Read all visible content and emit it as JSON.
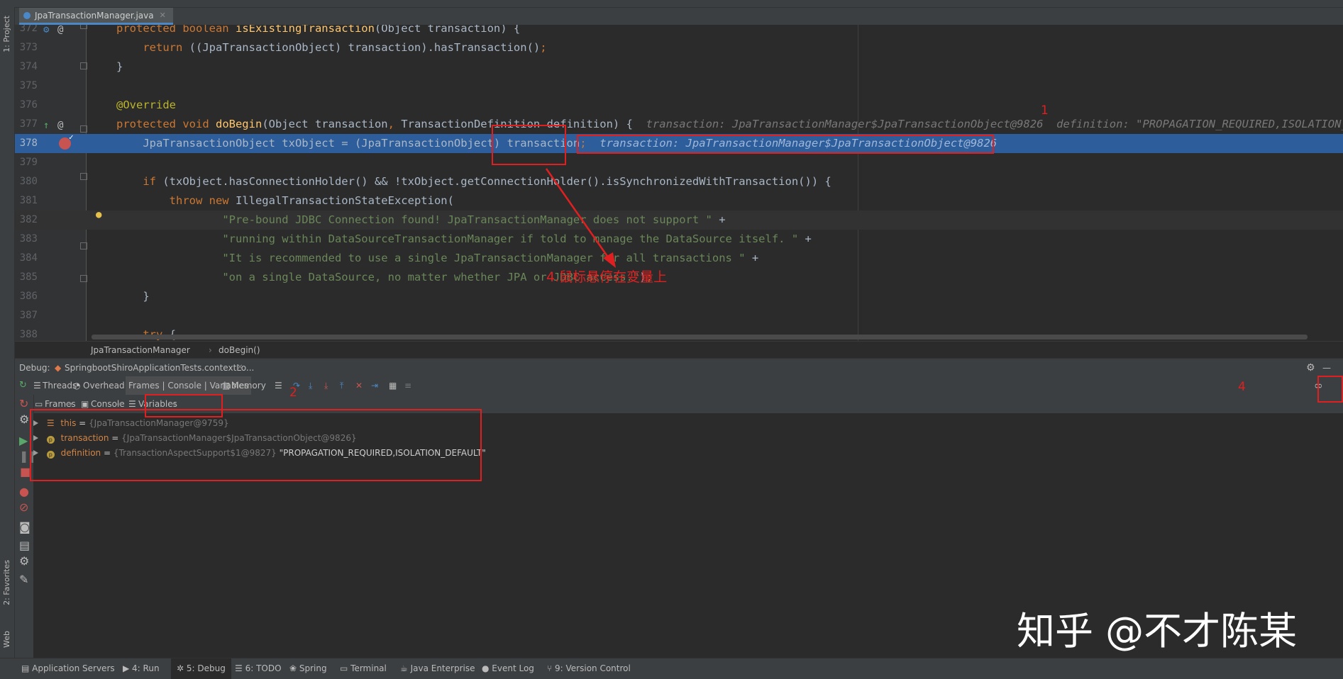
{
  "side_tabs": {
    "project": "1: Project",
    "favorites": "2: Favorites",
    "web": "Web"
  },
  "editor_tab": {
    "filename": "JpaTransactionManager.java"
  },
  "code_lines": [
    {
      "no": "372",
      "html": "<span class=\"kw\">protected boolean </span><span class=\"fn\">isExistingTransaction</span>(Object transaction) {"
    },
    {
      "no": "373",
      "html": "    <span class=\"kw\">return </span>((JpaTransactionObject) transaction).hasTransaction()<span class=\"kw\">;</span>"
    },
    {
      "no": "374",
      "html": "}"
    },
    {
      "no": "375",
      "html": ""
    },
    {
      "no": "376",
      "html": "<span class=\"an\">@Override</span>"
    },
    {
      "no": "377",
      "html": "<span class=\"kw\">protected void </span><span class=\"fn\">doBegin</span>(Object transaction<span class=\"kw\">, </span>TransactionDefinition definition) {  <span class=\"inl\">transaction: JpaTransactionManager$JpaTransactionObject@9826  definition: \"PROPAGATION_REQUIRED,ISOLATION_DEFAULT\"</span>"
    },
    {
      "no": "378",
      "html": "    JpaTransactionObject txObject = (JpaTransactionObject) transaction<span class=\"kw\">;  </span><span class=\"inl\">transaction: JpaTransactionManager$JpaTransactionObject@9826</span>"
    },
    {
      "no": "379",
      "html": ""
    },
    {
      "no": "380",
      "html": "    <span class=\"kw\">if </span>(txObject.hasConnectionHolder() &amp;&amp; !txObject.getConnectionHolder().isSynchronizedWithTransaction()) {"
    },
    {
      "no": "381",
      "html": "        <span class=\"kw\">throw new </span>IllegalTransactionStateException("
    },
    {
      "no": "382",
      "html": "                <span class=\"str\">\"Pre-bound JDBC Connection found! JpaTransactionManager does not support \"</span> +"
    },
    {
      "no": "383",
      "html": "                <span class=\"str\">\"running within DataSourceTransactionManager if told to manage the DataSource itself. \"</span> +"
    },
    {
      "no": "384",
      "html": "                <span class=\"str\">\"It is recommended to use a single JpaTransactionManager for all transactions \"</span> +"
    },
    {
      "no": "385",
      "html": "                <span class=\"str\">\"on a single DataSource, no matter whether JPA or JDBC access.\"</span>)<span class=\"kw\">;</span>"
    },
    {
      "no": "386",
      "html": "    }"
    },
    {
      "no": "387",
      "html": ""
    },
    {
      "no": "388",
      "html": "    <span class=\"kw\">try </span>{"
    }
  ],
  "breadcrumb": {
    "class": "JpaTransactionManager",
    "method": "doBegin()"
  },
  "debug": {
    "label": "Debug:",
    "session_tab": "SpringbootShiroApplicationTests.contextLo...",
    "toolbar": {
      "threads": "Threads",
      "overhead": "Overhead",
      "frames_console_variables": "Frames | Console | Variables",
      "memory": "Memory"
    },
    "subtabs": {
      "frames": "Frames",
      "console": "Console",
      "variables": "Variables"
    },
    "variables": [
      {
        "name": "this",
        "ref": "{JpaTransactionManager@9759}",
        "value": ""
      },
      {
        "name": "transaction",
        "ref": "{JpaTransactionManager$JpaTransactionObject@9826}",
        "value": ""
      },
      {
        "name": "definition",
        "ref": "{TransactionAspectSupport$1@9827}",
        "value": "\"PROPAGATION_REQUIRED,ISOLATION_DEFAULT\""
      }
    ]
  },
  "status_tabs": [
    "Application Servers",
    "4: Run",
    "5: Debug",
    "6: TODO",
    "Spring",
    "Terminal",
    "Java Enterprise",
    "Event Log",
    "9: Version Control"
  ],
  "annotations": {
    "n1": "1",
    "n2": "2",
    "n4": "4",
    "note": "4.鼠标悬停在变量上"
  },
  "watermark": "知乎 @不才陈某",
  "colors": {
    "highlight": "#2d5d9b",
    "annotation_red": "#e02020",
    "keyword": "#cc7832",
    "string": "#6a8759",
    "method": "#ffc66d"
  }
}
